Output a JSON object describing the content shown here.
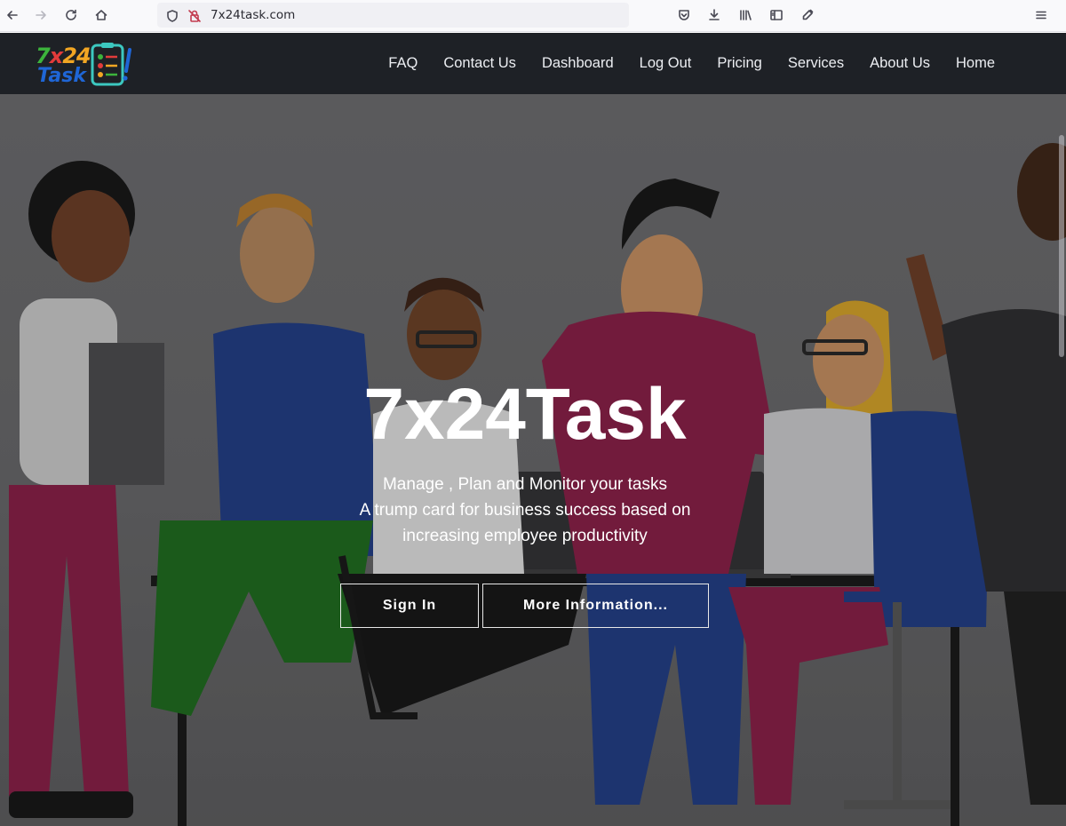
{
  "browser": {
    "url": "7x24task.com",
    "icons": [
      "back-arrow-icon",
      "forward-arrow-icon",
      "reload-icon",
      "home-icon",
      "shield-icon",
      "insecure-lock-icon",
      "pocket-icon",
      "download-icon",
      "library-icon",
      "sidebar-icon",
      "eyedropper-icon",
      "menu-icon"
    ]
  },
  "site": {
    "logo": {
      "top_text": "7x24",
      "bottom_text": "Task",
      "colors": [
        "#3cb43c",
        "#e23b3b",
        "#f2a623",
        "#1f66d6"
      ]
    },
    "nav": [
      {
        "label": "FAQ"
      },
      {
        "label": "Contact Us"
      },
      {
        "label": "Dashboard"
      },
      {
        "label": "Log Out"
      },
      {
        "label": "Pricing"
      },
      {
        "label": "Services"
      },
      {
        "label": "About Us"
      },
      {
        "label": "Home"
      }
    ]
  },
  "hero": {
    "title": "7x24Task",
    "lines": [
      "Manage , Plan and Monitor your tasks",
      "A trump card for business success based on",
      "increasing employee productivity"
    ],
    "buttons": {
      "signin": "Sign In",
      "more": "More Information..."
    }
  },
  "colors": {
    "navbar": "#1e2126",
    "accent_magenta": "#a01e4e",
    "accent_blue": "#1f3f8a"
  }
}
